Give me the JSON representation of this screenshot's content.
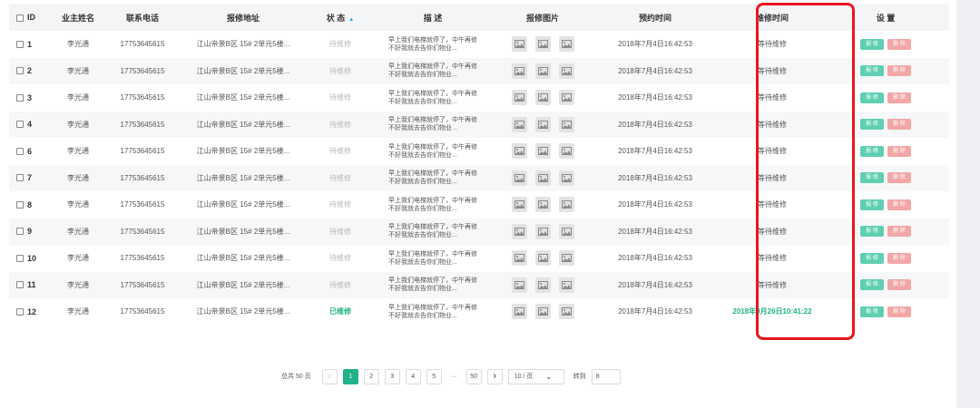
{
  "header": {
    "id": "ID",
    "owner": "业主姓名",
    "phone": "联系电话",
    "address": "报修地址",
    "status": "状 态",
    "desc": "描 述",
    "images": "报修图片",
    "appointment": "预约时间",
    "repair_time": "维修时间",
    "settings": "设 置"
  },
  "rows": [
    {
      "id": "1",
      "name": "李光通",
      "phone": "17753645615",
      "address": "江山帝景B区 15# 2单元5楼...",
      "status": "待维修",
      "done": false,
      "desc1": "早上我们电梯就停了，中午再修",
      "desc2": "不好我就去告你们物业...",
      "appt": "2018年7月4日16:42:53",
      "repair": "等待维修",
      "report": "报 修",
      "del": "删 除"
    },
    {
      "id": "2",
      "name": "李光通",
      "phone": "17753645615",
      "address": "江山帝景B区 15# 2单元5楼...",
      "status": "待维修",
      "done": false,
      "desc1": "早上我们电梯就停了，中午再修",
      "desc2": "不好我就去告你们物业...",
      "appt": "2018年7月4日16:42:53",
      "repair": "等待维修",
      "report": "报 修",
      "del": "删 除"
    },
    {
      "id": "3",
      "name": "李光通",
      "phone": "17753645615",
      "address": "江山帝景B区 15# 2单元5楼...",
      "status": "待维修",
      "done": false,
      "desc1": "早上我们电梯就停了，中午再修",
      "desc2": "不好我就去告你们物业...",
      "appt": "2018年7月4日16:42:53",
      "repair": "等待维修",
      "report": "报 修",
      "del": "删 除"
    },
    {
      "id": "4",
      "name": "李光通",
      "phone": "17753645615",
      "address": "江山帝景B区 15# 2单元5楼...",
      "status": "待维修",
      "done": false,
      "desc1": "早上我们电梯就停了，中午再修",
      "desc2": "不好我就去告你们物业...",
      "appt": "2018年7月4日16:42:53",
      "repair": "等待维修",
      "report": "报 修",
      "del": "删 除"
    },
    {
      "id": "6",
      "name": "李光通",
      "phone": "17753645615",
      "address": "江山帝景B区 15# 2单元5楼...",
      "status": "待维修",
      "done": false,
      "desc1": "早上我们电梯就停了，中午再修",
      "desc2": "不好我就去告你们物业...",
      "appt": "2018年7月4日16:42:53",
      "repair": "等待维修",
      "report": "报 修",
      "del": "删 除"
    },
    {
      "id": "7",
      "name": "李光通",
      "phone": "17753645615",
      "address": "江山帝景B区 15# 2单元5楼...",
      "status": "待维修",
      "done": false,
      "desc1": "早上我们电梯就停了，中午再修",
      "desc2": "不好我就去告你们物业...",
      "appt": "2018年7月4日16:42:53",
      "repair": "等待维修",
      "report": "报 修",
      "del": "删 除"
    },
    {
      "id": "8",
      "name": "李光通",
      "phone": "17753645615",
      "address": "江山帝景B区 15# 2单元5楼...",
      "status": "待维修",
      "done": false,
      "desc1": "早上我们电梯就停了，中午再修",
      "desc2": "不好我就去告你们物业...",
      "appt": "2018年7月4日16:42:53",
      "repair": "等待维修",
      "report": "报 修",
      "del": "删 除"
    },
    {
      "id": "9",
      "name": "李光通",
      "phone": "17753645615",
      "address": "江山帝景B区 15# 2单元5楼...",
      "status": "待维修",
      "done": false,
      "desc1": "早上我们电梯就停了，中午再修",
      "desc2": "不好我就去告你们物业...",
      "appt": "2018年7月4日16:42:53",
      "repair": "等待维修",
      "report": "报 修",
      "del": "删 除"
    },
    {
      "id": "10",
      "name": "李光通",
      "phone": "17753645615",
      "address": "江山帝景B区 15# 2单元5楼...",
      "status": "待维修",
      "done": false,
      "desc1": "早上我们电梯就停了，中午再修",
      "desc2": "不好我就去告你们物业...",
      "appt": "2018年7月4日16:42:53",
      "repair": "等待维修",
      "report": "报 修",
      "del": "删 除"
    },
    {
      "id": "11",
      "name": "李光通",
      "phone": "17753645615",
      "address": "江山帝景B区 15# 2单元5楼...",
      "status": "待维修",
      "done": false,
      "desc1": "早上我们电梯就停了，中午再修",
      "desc2": "不好我就去告你们物业...",
      "appt": "2018年7月4日16:42:53",
      "repair": "等待维修",
      "report": "报 修",
      "del": "删 除"
    },
    {
      "id": "12",
      "name": "李光通",
      "phone": "17753645615",
      "address": "江山帝景B区 15# 2单元5楼...",
      "status": "已维修",
      "done": true,
      "desc1": "早上我们电梯就停了，中午再修",
      "desc2": "不好我就去告你们物业...",
      "appt": "2018年7月4日16:42:53",
      "repair": "2018年9月26日10:41:22",
      "report": "报 修",
      "del": "删 除"
    }
  ],
  "pagination": {
    "total": "总共 50 页",
    "pages": [
      "1",
      "2",
      "3",
      "4",
      "5"
    ],
    "current": "1",
    "ellipsis": "···",
    "last": "50",
    "page_size": "10 / 页",
    "jump_label": "转到",
    "jump_value": "8"
  },
  "colors": {
    "accent_green": "#21b287",
    "report_btn": "#5fcfb0",
    "delete_btn": "#f2a6a6",
    "highlight_border": "#e8171e"
  },
  "icons": {
    "image": "image-placeholder-icon",
    "sort": "sort-arrow-icon",
    "prev": "chevron-left-icon",
    "next": "chevron-right-icon",
    "dropdown": "chevron-down-icon"
  }
}
